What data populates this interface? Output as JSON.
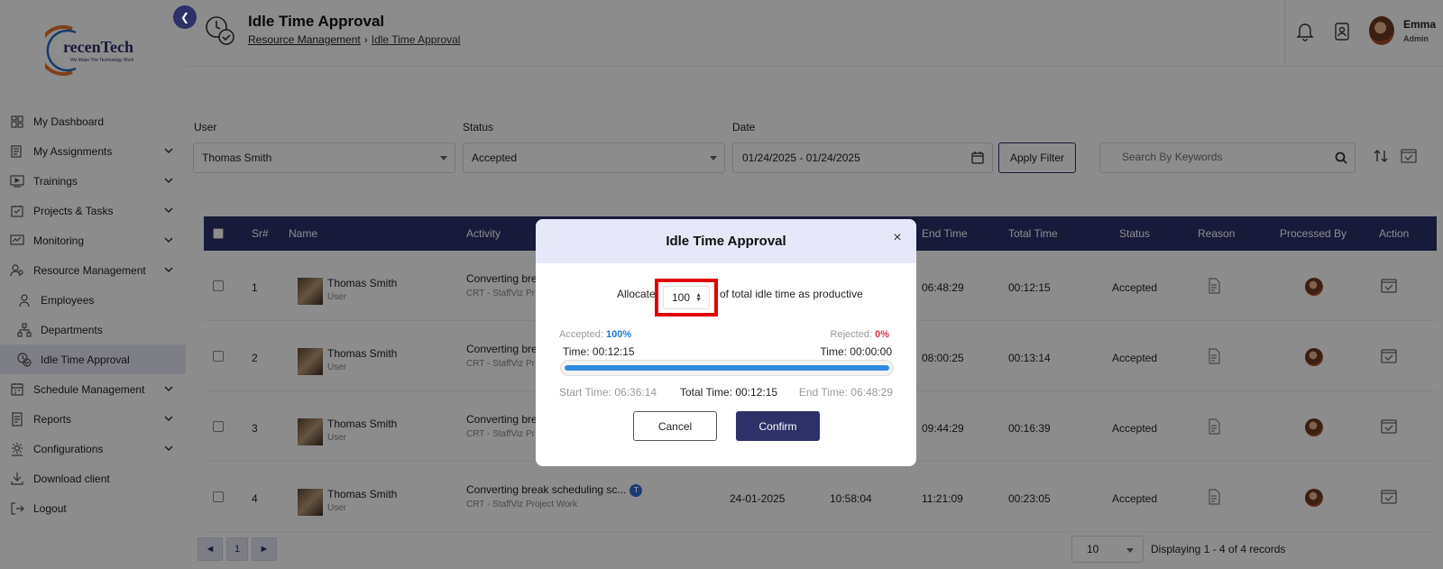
{
  "sidebar": {
    "logo_text": "recenTech",
    "logo_tagline": "We Make The Technology Work",
    "items": [
      {
        "label": "My Dashboard",
        "icon": "dashboard-icon"
      },
      {
        "label": "My Assignments",
        "icon": "assignments-icon"
      },
      {
        "label": "Trainings",
        "icon": "trainings-icon"
      },
      {
        "label": "Projects & Tasks",
        "icon": "projects-icon"
      },
      {
        "label": "Monitoring",
        "icon": "monitoring-icon"
      },
      {
        "label": "Resource Management",
        "icon": "resource-icon"
      },
      {
        "label": "Employees",
        "icon": "employees-icon"
      },
      {
        "label": "Departments",
        "icon": "departments-icon"
      },
      {
        "label": "Idle Time Approval",
        "icon": "idle-time-icon"
      },
      {
        "label": "Schedule Management",
        "icon": "schedule-icon"
      },
      {
        "label": "Reports",
        "icon": "reports-icon"
      },
      {
        "label": "Configurations",
        "icon": "configurations-icon"
      },
      {
        "label": "Download client",
        "icon": "download-icon"
      },
      {
        "label": "Logout",
        "icon": "logout-icon"
      }
    ]
  },
  "header": {
    "title": "Idle Time Approval",
    "breadcrumb_parent": "Resource Management",
    "breadcrumb_sep": "›",
    "breadcrumb_current": "Idle Time Approval",
    "user_name": "Emma",
    "user_role": "Admin"
  },
  "filters": {
    "user_label": "User",
    "user_value": "Thomas Smith",
    "status_label": "Status",
    "status_value": "Accepted",
    "date_label": "Date",
    "date_value": "01/24/2025 - 01/24/2025",
    "apply_label": "Apply Filter",
    "search_placeholder": "Search By Keywords"
  },
  "table": {
    "headers": {
      "sr": "Sr#",
      "name": "Name",
      "activity": "Activity",
      "end": "End Time",
      "total": "Total Time",
      "status": "Status",
      "reason": "Reason",
      "processed": "Processed By",
      "action": "Action"
    },
    "rows": [
      {
        "sr": "1",
        "name": "Thomas Smith",
        "role": "User",
        "activity": "Converting bre",
        "activity_sub": "CRT - StaffViz Pr",
        "end": "06:48:29",
        "total": "00:12:15",
        "status": "Accepted"
      },
      {
        "sr": "2",
        "name": "Thomas Smith",
        "role": "User",
        "activity": "Converting bre",
        "activity_sub": "CRT - StaffViz Pr",
        "end": "08:00:25",
        "total": "00:13:14",
        "status": "Accepted"
      },
      {
        "sr": "3",
        "name": "Thomas Smith",
        "role": "User",
        "activity": "Converting bre",
        "activity_sub": "CRT - StaffViz Pr",
        "end": "09:44:29",
        "total": "00:16:39",
        "status": "Accepted"
      },
      {
        "sr": "4",
        "name": "Thomas Smith",
        "role": "User",
        "activity": "Converting break scheduling sc...",
        "activity_sub": "CRT - StaffViz Project Work",
        "date": "24-01-2025",
        "start": "10:58:04",
        "end": "11:21:09",
        "total": "00:23:05",
        "status": "Accepted",
        "badge": "T"
      }
    ]
  },
  "pagination": {
    "prev": "◄",
    "page": "1",
    "next": "►",
    "page_size": "10",
    "records": "Displaying 1 - 4 of 4 records"
  },
  "modal": {
    "title": "Idle Time Approval",
    "close": "×",
    "allocate_pre": "Allocate",
    "allocate_value": "100",
    "allocate_post": "of total idle time as productive",
    "accepted_label": "Accepted:",
    "accepted_pct": "100%",
    "accepted_fraction": 1.0,
    "rejected_label": "Rejected:",
    "rejected_pct": "0%",
    "accepted_time": "Time: 00:12:15",
    "rejected_time": "Time: 00:00:00",
    "start_time": "Start Time: 06:36:14",
    "total_time": "Total Time: 00:12:15",
    "end_time": "End Time: 06:48:29",
    "cancel_label": "Cancel",
    "confirm_label": "Confirm"
  },
  "colors": {
    "primary": "#2d3168",
    "accepted": "#1f78d6",
    "rejected": "#d6334a",
    "highlight": "#e00000",
    "progress": "#2f8be0"
  }
}
